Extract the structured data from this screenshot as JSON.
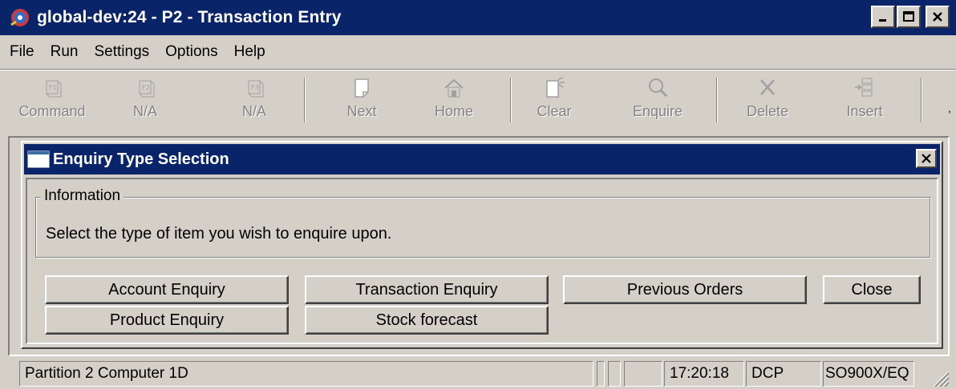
{
  "window": {
    "title": "global-dev:24 - P2 - Transaction Entry",
    "title_bar_color": "#0a246a"
  },
  "menu": [
    "File",
    "Run",
    "Settings",
    "Options",
    "Help"
  ],
  "toolbar": {
    "buttons": [
      {
        "label": "Command",
        "icon": "f1-key-icon"
      },
      {
        "label": "N/A",
        "icon": "f2-key-icon"
      },
      {
        "label": "N/A",
        "icon": "f3-key-icon"
      },
      {
        "label": "Next",
        "icon": "next-page-icon"
      },
      {
        "label": "Home",
        "icon": "home-icon"
      },
      {
        "label": "Clear",
        "icon": "clear-icon"
      },
      {
        "label": "Enquire",
        "icon": "magnifier-icon"
      },
      {
        "label": "Delete",
        "icon": "delete-x-icon"
      },
      {
        "label": "Insert",
        "icon": "insert-icon"
      }
    ]
  },
  "dialog": {
    "title": "Enquiry Type Selection",
    "group_label": "Information",
    "info_text": "Select the type of item you wish to enquire upon.",
    "buttons": {
      "account": "Account Enquiry",
      "transaction": "Transaction Enquiry",
      "previous_orders": "Previous Orders",
      "close": "Close",
      "product": "Product Enquiry",
      "stock_forecast": "Stock forecast"
    }
  },
  "status": {
    "partition": "Partition 2 Computer 1D",
    "time": "17:20:18",
    "mode": "DCP",
    "program": "SO900X/EQ"
  }
}
